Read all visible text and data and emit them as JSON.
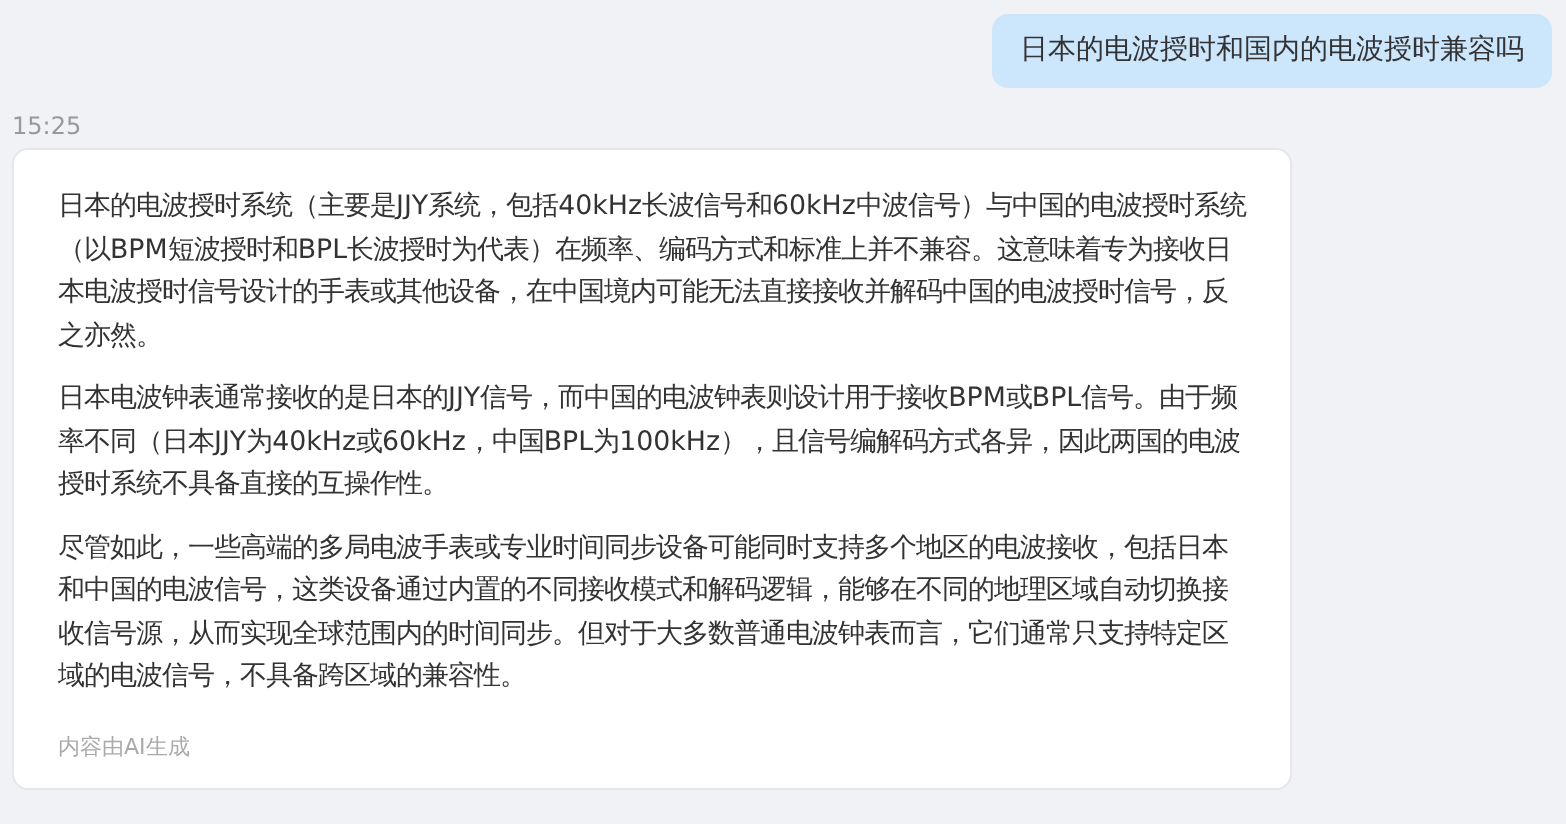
{
  "user_message": {
    "text": "日本的电波授时和国内的电波授时兼容吗"
  },
  "timestamp": "15:25",
  "reply": {
    "paragraphs": [
      "日本的电波授时系统（主要是JJY系统，包括40kHz长波信号和60kHz中波信号）与中国的电波授时系统（以BPM短波授时和BPL长波授时为代表）在频率、编码方式和标准上并不兼容。这意味着专为接收日本电波授时信号设计的手表或其他设备，在中国境内可能无法直接接收并解码中国的电波授时信号，反之亦然。",
      "日本电波钟表通常接收的是日本的JJY信号，而中国的电波钟表则设计用于接收BPM或BPL信号。由于频率不同（日本JJY为40kHz或60kHz，中国BPL为100kHz），且信号编解码方式各异，因此两国的电波授时系统不具备直接的互操作性。",
      "尽管如此，一些高端的多局电波手表或专业时间同步设备可能同时支持多个地区的电波接收，包括日本和中国的电波信号，这类设备通过内置的不同接收模式和解码逻辑，能够在不同的地理区域自动切换接收信号源，从而实现全球范围内的时间同步。但对于大多数普通电波钟表而言，它们通常只支持特定区域的电波信号，不具备跨区域的兼容性。"
    ],
    "footer": "内容由AI生成"
  }
}
